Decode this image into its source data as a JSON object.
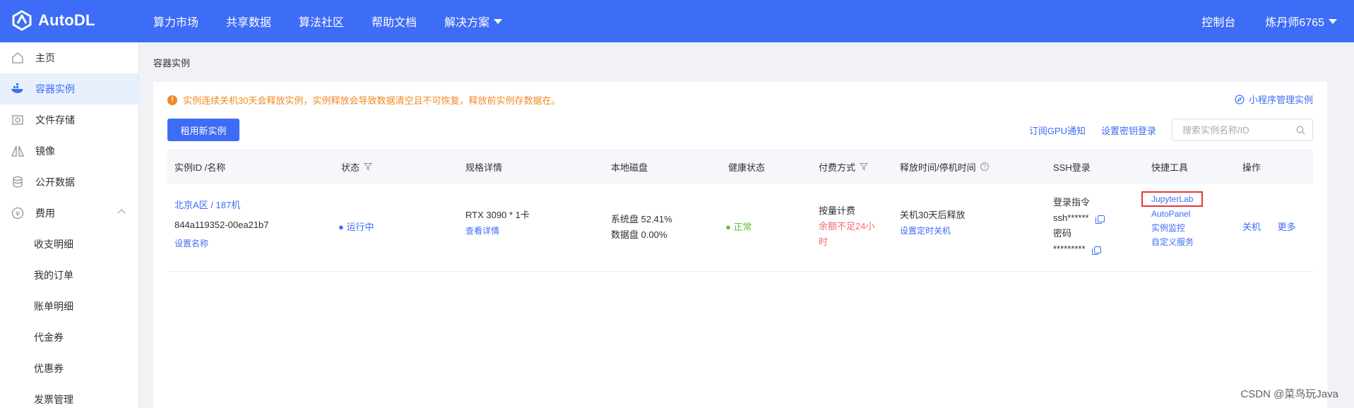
{
  "app": {
    "logo_text": "AutoDL"
  },
  "topnav": {
    "items": [
      "算力市场",
      "共享数据",
      "算法社区",
      "帮助文档",
      "解决方案"
    ],
    "console": "控制台",
    "user": "炼丹师6765"
  },
  "sidebar": {
    "items": [
      {
        "label": "主页",
        "icon": "home-icon"
      },
      {
        "label": "容器实例",
        "icon": "container-icon"
      },
      {
        "label": "文件存储",
        "icon": "storage-icon"
      },
      {
        "label": "镜像",
        "icon": "mirror-icon"
      },
      {
        "label": "公开数据",
        "icon": "database-icon"
      },
      {
        "label": "费用",
        "icon": "yen-icon"
      }
    ],
    "subitems": [
      "收支明细",
      "我的订单",
      "账单明细",
      "代金券",
      "优惠券",
      "发票管理"
    ]
  },
  "main": {
    "breadcrumb": "容器实例",
    "notice": "实例连续关机30天会释放实例，实例释放会导致数据清空且不可恢复，释放前实例存数据在。",
    "mini_program_link": "小程序管理实例",
    "rent_button": "租用新实例",
    "subscribe_gpu": "订阅GPU通知",
    "set_key_login": "设置密钥登录",
    "search_placeholder": "搜索实例名称/ID"
  },
  "table": {
    "headers": [
      "实例ID /名称",
      "状态",
      "规格详情",
      "本地磁盘",
      "健康状态",
      "付费方式",
      "释放时间/停机时间",
      "SSH登录",
      "快捷工具",
      "操作"
    ],
    "row": {
      "region_name": "北京A区 / 187机",
      "instance_id": "844a119352-00ea21b7",
      "set_name": "设置名称",
      "status": "运行中",
      "spec": "RTX 3090 * 1卡",
      "spec_detail": "查看详情",
      "system_disk": "系统盘 52.41%",
      "data_disk": "数据盘 0.00%",
      "health": "正常",
      "billing": "按量计费",
      "balance_warning_line1": "余额不足24小",
      "balance_warning_line2": "时",
      "release": "关机30天后释放",
      "set_shutdown": "设置定时关机",
      "ssh_label": "登录指令",
      "ssh_value": "ssh******",
      "password_label": "密码",
      "password_value": "*********",
      "tools": [
        "JupyterLab",
        "AutoPanel",
        "实例监控",
        "自定义服务"
      ],
      "actions": [
        "关机",
        "更多"
      ]
    }
  },
  "watermark": "CSDN @菜鸟玩Java",
  "colors": {
    "brand": "#3d6cf6",
    "warning": "#f08a24",
    "success": "#67c23a",
    "danger": "#f56c6c",
    "highlight_box": "#e53935"
  }
}
